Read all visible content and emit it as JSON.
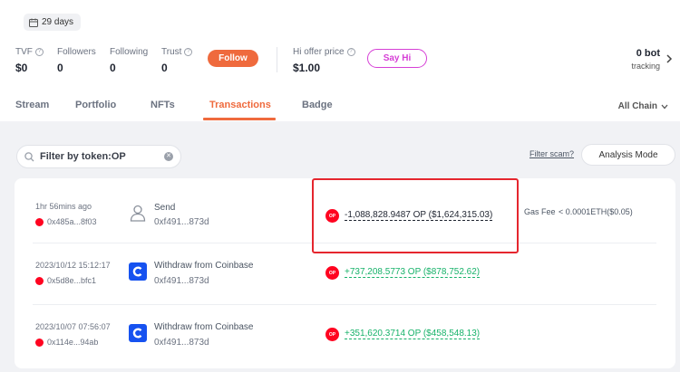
{
  "profile": {
    "days_badge": "29 days"
  },
  "stats": [
    {
      "label": "TVF",
      "value": "$0",
      "has_help": true
    },
    {
      "label": "Followers",
      "value": "0",
      "has_help": false
    },
    {
      "label": "Following",
      "value": "0",
      "has_help": false
    },
    {
      "label": "Trust",
      "value": "0",
      "has_help": true
    }
  ],
  "follow_button": "Follow",
  "hi_offer": {
    "label": "Hi offer price",
    "value": "$1.00"
  },
  "say_hi_button": "Say Hi",
  "bot_tracking": {
    "value": "0 bot",
    "sub": "tracking"
  },
  "tabs": [
    {
      "label": "Stream",
      "active": false
    },
    {
      "label": "Portfolio",
      "active": false
    },
    {
      "label": "NFTs",
      "active": false
    },
    {
      "label": "Transactions",
      "active": true
    },
    {
      "label": "Badge",
      "active": false
    }
  ],
  "chain_select": "All Chain",
  "search": {
    "placeholder": "Filter by token:OP"
  },
  "filter_scam": "Filter scam?",
  "analysis_mode_button": "Analysis Mode",
  "token_icon_text": "OP",
  "transactions": [
    {
      "time": "1hr 56mins ago",
      "hash": "0x485a...8f03",
      "icon": "user-icon",
      "type": "Send",
      "address": "0xf491...873d",
      "amount": "-1,088,828.9487 OP ($1,624,315.03)",
      "direction": "out",
      "gas_label": "Gas Fee",
      "gas_value": "< 0.0001ETH($0.05)"
    },
    {
      "time": "2023/10/12 15:12:17",
      "hash": "0x5d8e...bfc1",
      "icon": "coinbase-icon",
      "type": "Withdraw from Coinbase",
      "address": "0xf491...873d",
      "amount": "+737,208.5773 OP ($878,752.62)",
      "direction": "in"
    },
    {
      "time": "2023/10/07 07:56:07",
      "hash": "0x114e...94ab",
      "icon": "coinbase-icon",
      "type": "Withdraw from Coinbase",
      "address": "0xf491...873d",
      "amount": "+351,620.3714 OP ($458,548.13)",
      "direction": "in"
    }
  ],
  "colors": {
    "accent": "#ef6a3d",
    "say_hi": "#d63fd6",
    "positive": "#17b26a",
    "op_red": "#ff0420",
    "coinbase_blue": "#1652f0",
    "highlight": "#e5262e"
  }
}
